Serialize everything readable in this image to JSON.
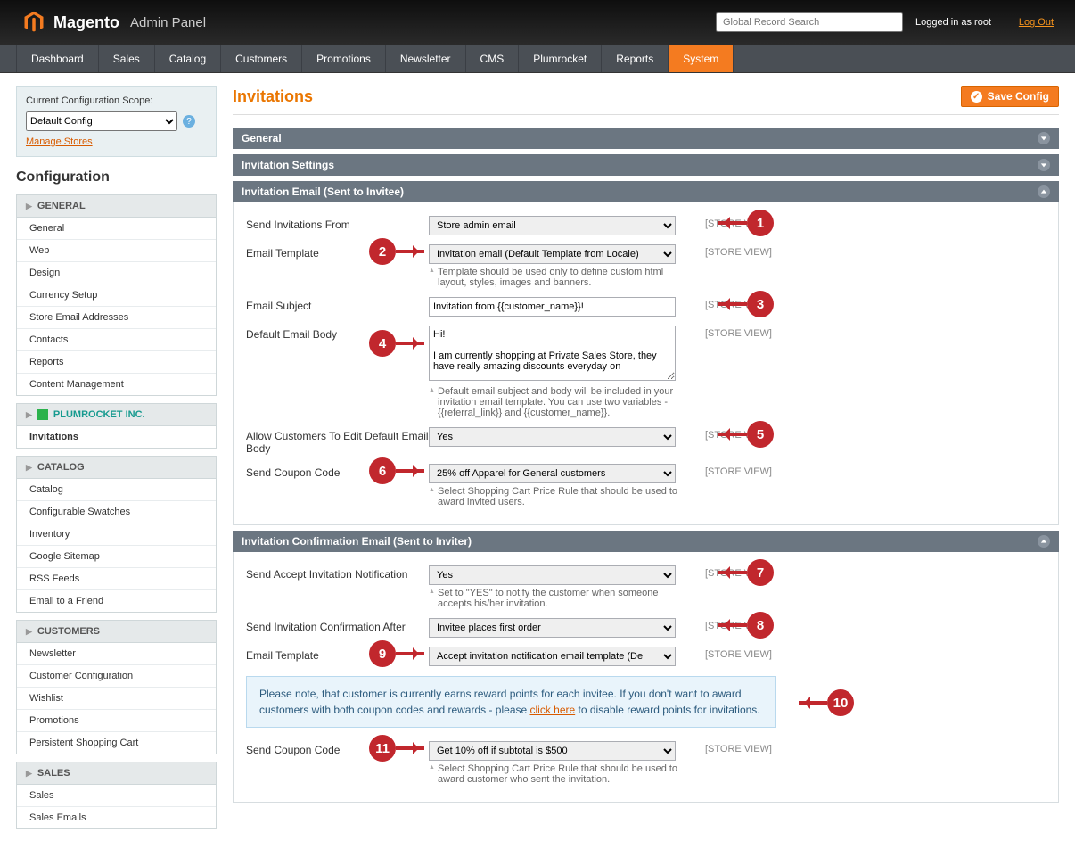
{
  "header": {
    "brand": "Magento",
    "brand_sub": "Admin Panel",
    "search_placeholder": "Global Record Search",
    "logged_in": "Logged in as root",
    "logout": "Log Out"
  },
  "topnav": [
    "Dashboard",
    "Sales",
    "Catalog",
    "Customers",
    "Promotions",
    "Newsletter",
    "CMS",
    "Plumrocket",
    "Reports",
    "System"
  ],
  "topnav_active": 9,
  "scope": {
    "label": "Current Configuration Scope:",
    "value": "Default Config",
    "manage": "Manage Stores"
  },
  "sidebar": {
    "title": "Configuration",
    "groups": [
      {
        "title": "GENERAL",
        "items": [
          "General",
          "Web",
          "Design",
          "Currency Setup",
          "Store Email Addresses",
          "Contacts",
          "Reports",
          "Content Management"
        ]
      },
      {
        "title": "PLUMROCKET INC.",
        "plum": true,
        "items": [
          "Invitations"
        ],
        "active": 0
      },
      {
        "title": "CATALOG",
        "items": [
          "Catalog",
          "Configurable Swatches",
          "Inventory",
          "Google Sitemap",
          "RSS Feeds",
          "Email to a Friend"
        ]
      },
      {
        "title": "CUSTOMERS",
        "items": [
          "Newsletter",
          "Customer Configuration",
          "Wishlist",
          "Promotions",
          "Persistent Shopping Cart"
        ]
      },
      {
        "title": "SALES",
        "items": [
          "Sales",
          "Sales Emails"
        ]
      }
    ]
  },
  "page": {
    "title": "Invitations",
    "save": "Save Config",
    "store_view": "[STORE VIEW]"
  },
  "sections": {
    "general": "General",
    "settings": "Invitation Settings",
    "email": {
      "title": "Invitation Email (Sent to Invitee)",
      "fields": {
        "from": {
          "label": "Send Invitations From",
          "value": "Store admin email"
        },
        "template": {
          "label": "Email Template",
          "value": "Invitation email (Default Template from Locale)",
          "note": "Template should be used only to define custom html layout, styles, images and banners."
        },
        "subject": {
          "label": "Email Subject",
          "value": "Invitation from {{customer_name}}!"
        },
        "body": {
          "label": "Default Email Body",
          "value": "Hi!\n\nI am currently shopping at Private Sales Store, they have really amazing discounts everyday on",
          "note": "Default email subject and body will be included in your invitation email template. You can use two variables - {{referral_link}} and {{customer_name}}."
        },
        "allow_edit": {
          "label": "Allow Customers To Edit Default Email Body",
          "value": "Yes"
        },
        "coupon": {
          "label": "Send Coupon Code",
          "value": "25% off Apparel for General customers",
          "note": "Select Shopping Cart Price Rule that should be used to award invited users."
        }
      }
    },
    "confirm": {
      "title": "Invitation Confirmation Email (Sent to Inviter)",
      "fields": {
        "notify": {
          "label": "Send Accept Invitation Notification",
          "value": "Yes",
          "note": "Set to \"YES\" to notify the customer when someone accepts his/her invitation."
        },
        "after": {
          "label": "Send Invitation Confirmation After",
          "value": "Invitee places first order"
        },
        "template": {
          "label": "Email Template",
          "value": "Accept invitation notification email template (De"
        },
        "coupon": {
          "label": "Send Coupon Code",
          "value": "Get 10% off if subtotal is $500",
          "note": "Select Shopping Cart Price Rule that should be used to award customer who sent the invitation."
        }
      },
      "info_pre": "Please note, that customer is currently earns reward points for each invitee. If you don't want to award customers with both coupon codes and rewards - please ",
      "info_link": "click here",
      "info_post": " to disable reward points for invitations."
    }
  },
  "callouts": [
    "1",
    "2",
    "3",
    "4",
    "5",
    "6",
    "7",
    "8",
    "9",
    "10",
    "11"
  ]
}
